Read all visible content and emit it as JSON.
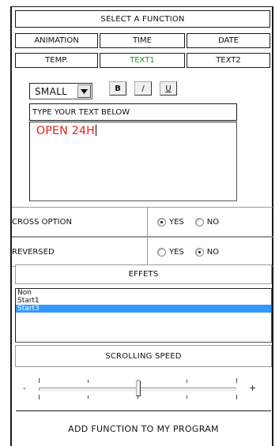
{
  "header": {
    "title": "SELECT A FUNCTION"
  },
  "functions": {
    "row1": [
      "ANIMATION",
      "TIME",
      "DATE"
    ],
    "row2": [
      "TEMP.",
      "TEXT1",
      "TEXT2"
    ],
    "selected": "TEXT1",
    "selected_color": "#1c9a1c"
  },
  "text_format": {
    "size": "SMALL",
    "bold": "B",
    "italic": "/",
    "underline": "U"
  },
  "text_input": {
    "label": "TYPE YOUR TEXT BELOW",
    "value": "OPEN 24H",
    "color": "#e0201a"
  },
  "options": {
    "cross": {
      "label": "CROSS OPTION",
      "yes": "YES",
      "no": "NO",
      "selected": "YES"
    },
    "reversed": {
      "label": "REVERSED",
      "yes": "YES",
      "no": "NO",
      "selected": "NO"
    }
  },
  "effects": {
    "title": "EFFETS",
    "items": [
      "Non",
      "Start1",
      "Start3"
    ],
    "selected": "Start3",
    "selected_color": "#3399ff"
  },
  "speed": {
    "title": "SCROLLING SPEED",
    "minus": "-",
    "plus": "+",
    "value": 0.5
  },
  "add_button": {
    "label": "ADD FUNCTION TO MY PROGRAM"
  }
}
